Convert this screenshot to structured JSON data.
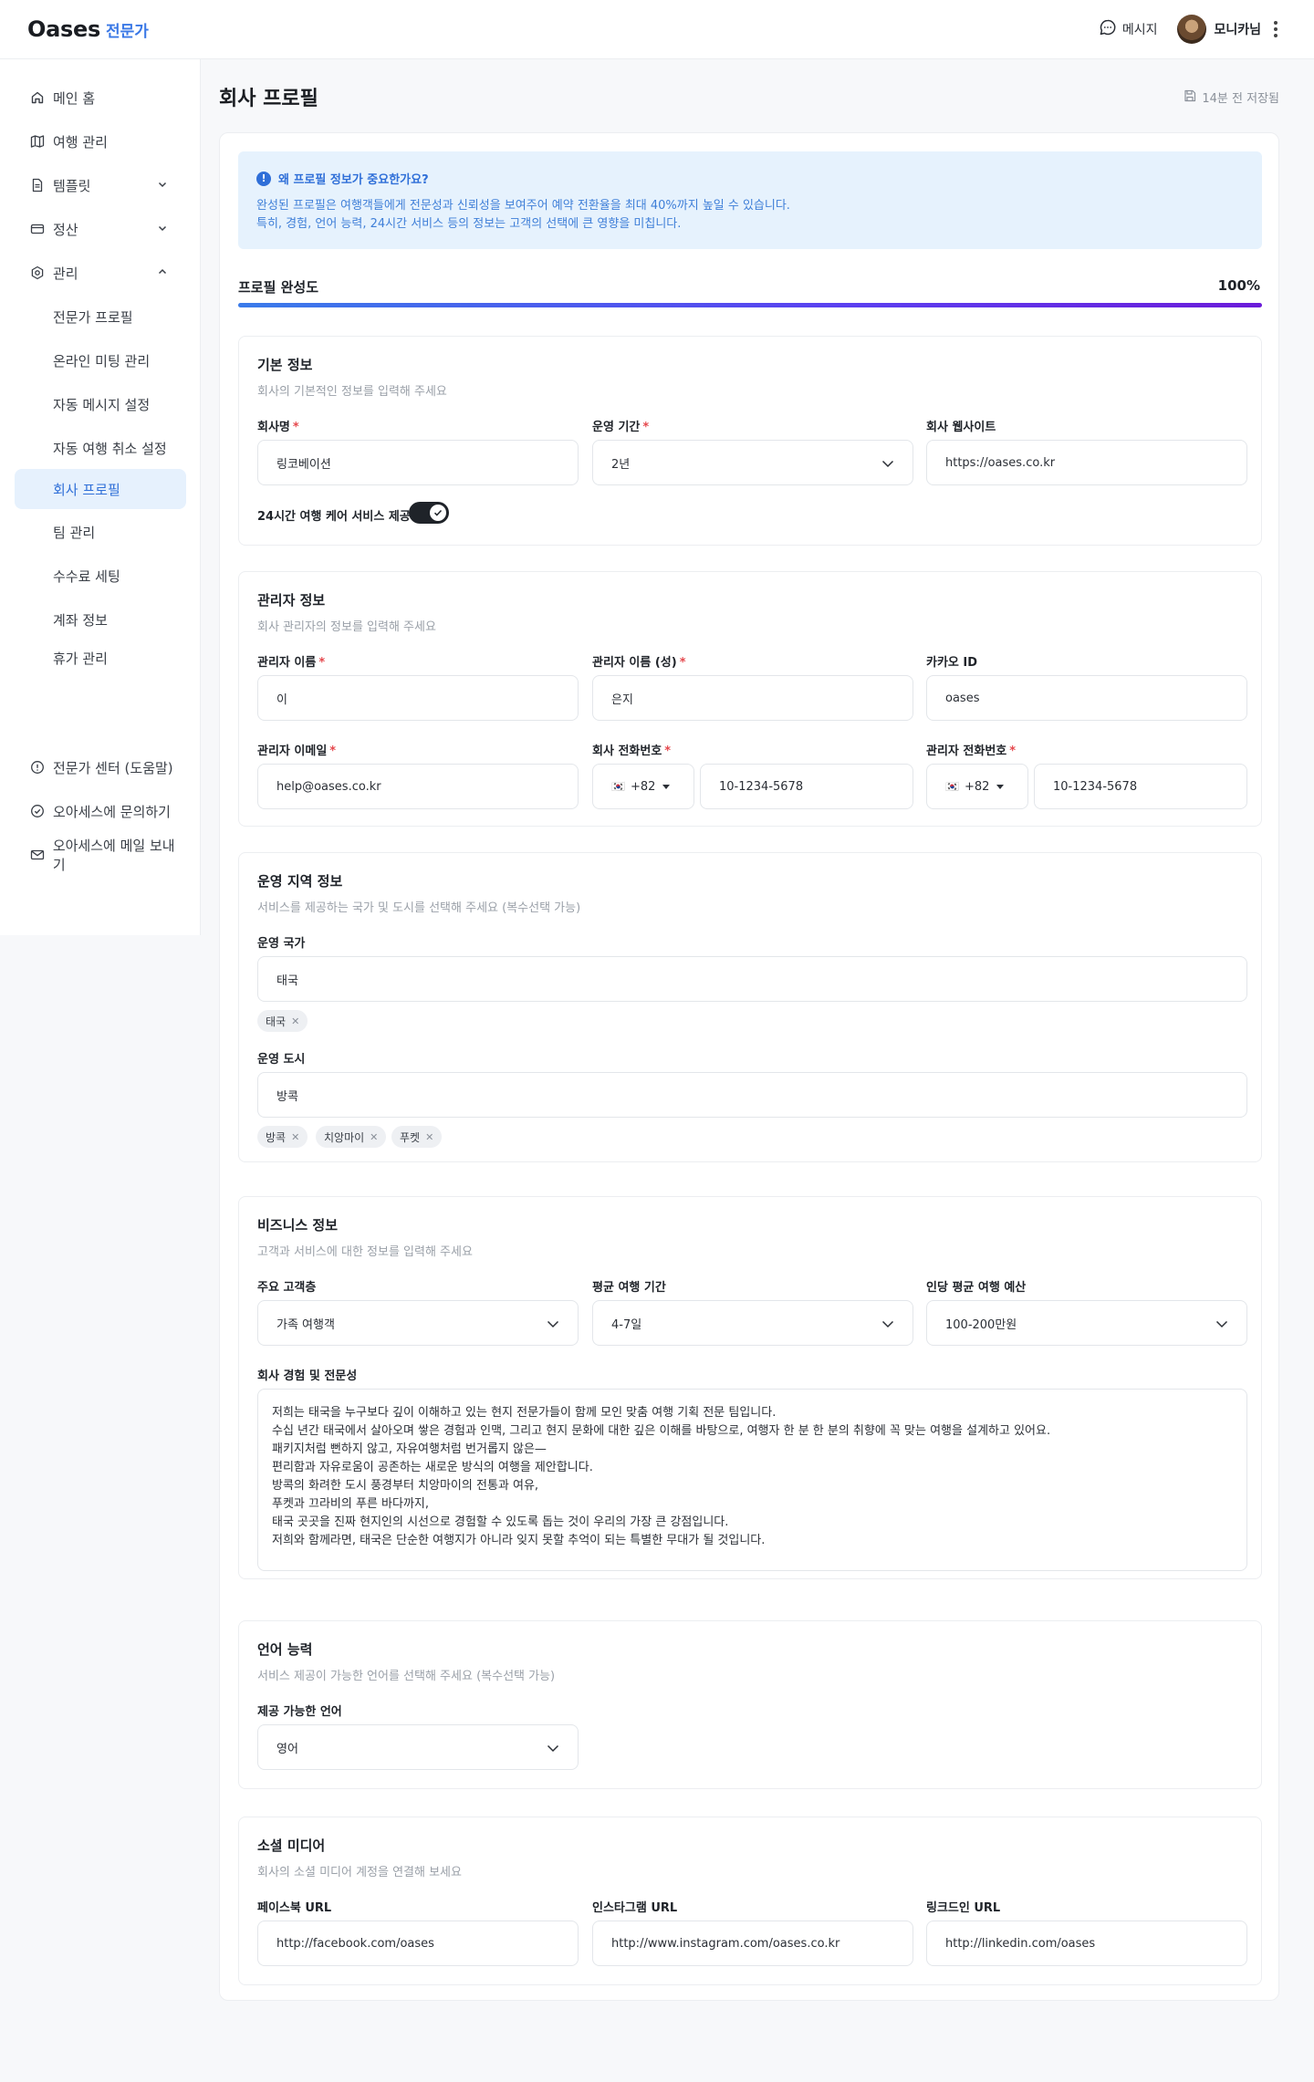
{
  "header": {
    "logo": "Oases",
    "logo_sub": "전문가",
    "message_label": "메시지",
    "username": "모니카님"
  },
  "sidebar": {
    "items": [
      {
        "label": "메인 홈",
        "icon": "home-icon"
      },
      {
        "label": "여행 관리",
        "icon": "map-icon"
      },
      {
        "label": "템플릿",
        "icon": "document-icon"
      },
      {
        "label": "정산",
        "icon": "credit-card-icon"
      },
      {
        "label": "관리",
        "icon": "gear-icon"
      },
      {
        "label": "전문가 프로필"
      },
      {
        "label": "온라인 미팅 관리"
      },
      {
        "label": "자동 메시지 설정"
      },
      {
        "label": "자동 여행 취소 설정"
      },
      {
        "label": "회사 프로필"
      },
      {
        "label": "팀 관리"
      },
      {
        "label": "수수료 세팅"
      },
      {
        "label": "계좌 정보"
      },
      {
        "label": "휴가 관리"
      },
      {
        "label": "전문가 센터 (도움말)",
        "icon": "info-circle-icon"
      },
      {
        "label": "오아세스에 문의하기",
        "icon": "check-circle-icon"
      },
      {
        "label": "오아세스에 메일 보내기",
        "icon": "mail-icon"
      }
    ],
    "active": "회사 프로필"
  },
  "page": {
    "title": "회사 프로필",
    "saved_status": "14분 전 저장됨"
  },
  "info": {
    "title": "왜 프로필 정보가 중요한가요?",
    "line1": "완성된 프로필은 여행객들에게 전문성과 신뢰성을 보여주어 예약 전환율을 최대 40%까지 높일 수 있습니다.",
    "line2": "특히, 경험, 언어 능력, 24시간 서비스 등의 정보는 고객의 선택에 큰 영향을 미칩니다."
  },
  "progress": {
    "label": "프로필 완성도",
    "value_text": "100%",
    "value": 100
  },
  "basic": {
    "title": "기본 정보",
    "subtitle": "회사의 기본적인 정보를 입력해 주세요",
    "company_name_label": "회사명",
    "company_name": "링코베이션",
    "period_label": "운영 기간",
    "period": "2년",
    "website_label": "회사 웹사이트",
    "website": "https://oases.co.kr",
    "care_label": "24시간 여행 케어 서비스 제공",
    "care_enabled": true
  },
  "manager": {
    "title": "관리자 정보",
    "subtitle": "회사 관리자의 정보를 입력해 주세요",
    "last_name_label": "관리자 이름",
    "last_name": "이",
    "first_name_label": "관리자 이름 (성)",
    "first_name": "은지",
    "kakao_label": "카카오 ID",
    "kakao": "oases",
    "email_label": "관리자 이메일",
    "email": "help@oases.co.kr",
    "company_phone_label": "회사 전화번호",
    "company_phone_code": "+82",
    "company_phone": "10-1234-5678",
    "manager_phone_label": "관리자 전화번호",
    "manager_phone_code": "+82",
    "manager_phone": "10-1234-5678"
  },
  "region": {
    "title": "운영 지역 정보",
    "subtitle": "서비스를 제공하는 국가 및 도시를 선택해 주세요 (복수선택 가능)",
    "country_label": "운영 국가",
    "country_input": "태국",
    "countries": [
      "태국"
    ],
    "city_label": "운영 도시",
    "city_input": "방콕",
    "cities": [
      "방콕",
      "치앙마이",
      "푸켓"
    ]
  },
  "business": {
    "title": "비즈니스 정보",
    "subtitle": "고객과 서비스에 대한 정보를 입력해 주세요",
    "audience_label": "주요 고객층",
    "audience": "가족 여행객",
    "duration_label": "평균 여행 기간",
    "duration": "4-7일",
    "budget_label": "인당 평균 여행 예산",
    "budget": "100-200만원",
    "experience_label": "회사 경험 및 전문성",
    "experience": [
      "저희는 태국을 누구보다 깊이 이해하고 있는 현지 전문가들이 함께 모인 맞춤 여행 기획 전문 팀입니다.",
      "수십 년간 태국에서 살아오며 쌓은 경험과 인맥, 그리고 현지 문화에 대한 깊은 이해를 바탕으로, 여행자 한 분 한 분의 취향에 꼭 맞는 여행을 설계하고 있어요.",
      "패키지처럼 뻔하지 않고, 자유여행처럼 번거롭지 않은—",
      "편리함과 자유로움이 공존하는 새로운 방식의 여행을 제안합니다.",
      "방콕의 화려한 도시 풍경부터 치앙마이의 전통과 여유,",
      "푸켓과 끄라비의 푸른 바다까지,",
      "태국 곳곳을 진짜 현지인의 시선으로 경험할 수 있도록 돕는 것이 우리의 가장 큰 강점입니다.",
      "저희와 함께라면, 태국은 단순한 여행지가 아니라 잊지 못할 추억이 되는 특별한 무대가 될 것입니다."
    ]
  },
  "language": {
    "title": "언어 능력",
    "subtitle": "서비스 제공이 가능한 언어를 선택해 주세요 (복수선택 가능)",
    "label": "제공 가능한 언어",
    "value": "영어"
  },
  "social": {
    "title": "소셜 미디어",
    "subtitle": "회사의 소셜 미디어 계정을 연결해 보세요",
    "facebook_label": "페이스북 URL",
    "facebook": "http://facebook.com/oases",
    "instagram_label": "인스타그램 URL",
    "instagram": "http://www.instagram.com/oases.co.kr",
    "linkedin_label": "링크드인 URL",
    "linkedin": "http://linkedin.com/oases"
  },
  "colors": {
    "accent": "#3a78e6",
    "active_bg": "#e6f1fd",
    "required": "#e5484d"
  }
}
